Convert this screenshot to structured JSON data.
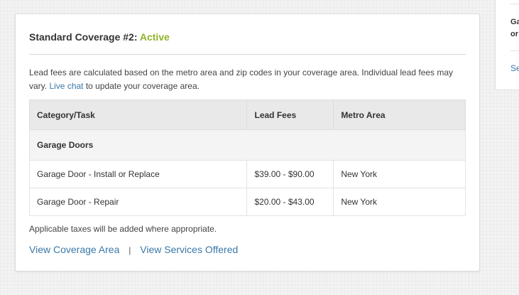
{
  "coverage": {
    "title": "Standard Coverage #2:",
    "status": "Active",
    "status_color": "#8fb32a",
    "description_pre": "Lead fees are calculated based on the metro area and zip codes in your coverage area. Individual lead fees may vary.",
    "live_chat_label": "Live chat",
    "description_post": "to update your coverage area.",
    "table": {
      "headers": [
        "Category/Task",
        "Lead Fees",
        "Metro Area"
      ],
      "group": "Garage Doors",
      "rows": [
        {
          "task": "Garage Door - Install or Replace",
          "fees": "$39.00 - $90.00",
          "metro": "New York"
        },
        {
          "task": "Garage Door - Repair",
          "fees": "$20.00 - $43.00",
          "metro": "New York"
        }
      ]
    },
    "taxes_note": "Applicable taxes will be added where appropriate.",
    "view_coverage_label": "View Coverage Area",
    "separator": "|",
    "view_services_label": "View Services Offered",
    "link_color": "#3a78a8"
  },
  "side_card": {
    "text_line1": "Ga",
    "text_line2": "or",
    "link_text": "Se"
  }
}
